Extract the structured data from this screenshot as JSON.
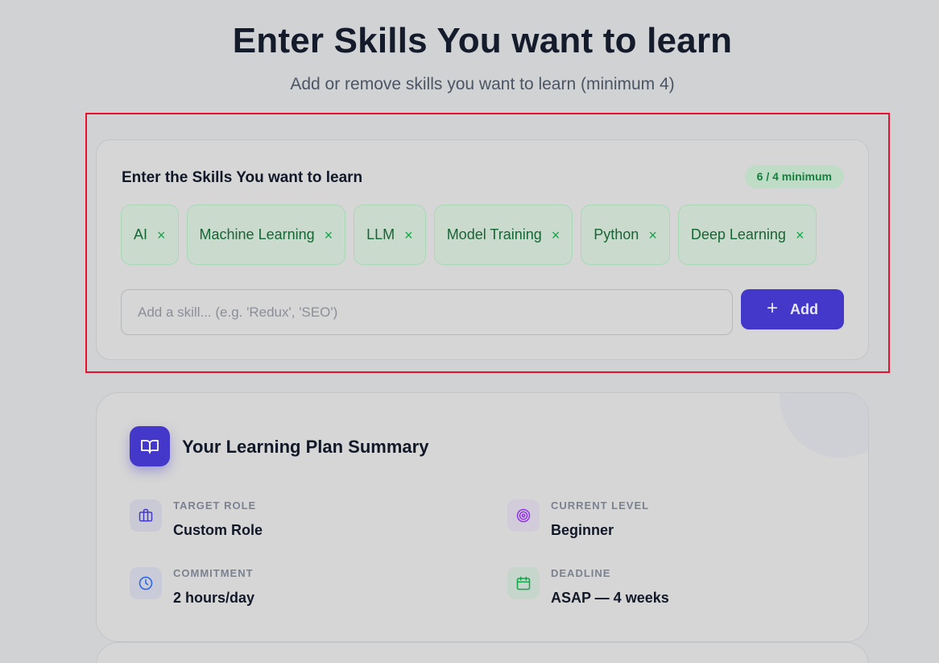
{
  "header": {
    "title": "Enter Skills You want to learn",
    "subtitle": "Add or remove skills you want to learn (minimum 4)"
  },
  "skills_card": {
    "heading": "Enter the Skills You want to learn",
    "count_badge": "6 / 4 minimum",
    "remove_glyph": "×",
    "chips": [
      {
        "label": "AI"
      },
      {
        "label": "Machine Learning"
      },
      {
        "label": "LLM"
      },
      {
        "label": "Model Training"
      },
      {
        "label": "Python"
      },
      {
        "label": "Deep Learning"
      }
    ],
    "input": {
      "value": "",
      "placeholder": "Add a skill... (e.g. 'Redux', 'SEO')"
    },
    "add_button": {
      "label": "Add",
      "icon": "plus-icon"
    }
  },
  "summary": {
    "title": "Your Learning Plan Summary",
    "icon": "book-open-icon",
    "items": [
      {
        "label": "TARGET ROLE",
        "value": "Custom Role",
        "icon": "briefcase-icon"
      },
      {
        "label": "CURRENT LEVEL",
        "value": "Beginner",
        "icon": "target-icon"
      },
      {
        "label": "COMMITMENT",
        "value": "2 hours/day",
        "icon": "clock-icon"
      },
      {
        "label": "DEADLINE",
        "value": "ASAP — 4 weeks",
        "icon": "calendar-icon"
      }
    ]
  },
  "colors": {
    "accent": "#4338ca",
    "chip_text": "#166534",
    "highlight": "#e5112f"
  }
}
